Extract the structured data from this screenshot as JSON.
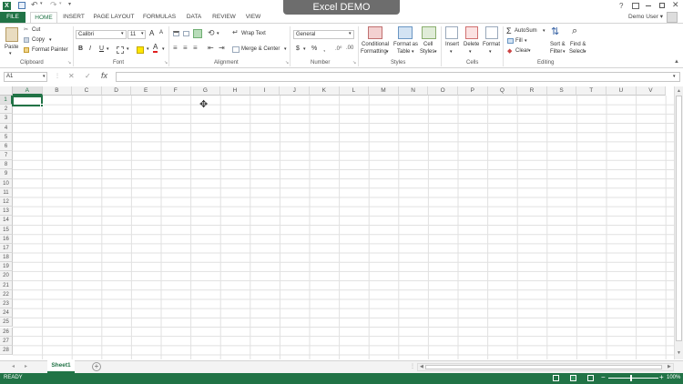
{
  "title": "Excel DEMO",
  "user": "Demo User",
  "tabs": [
    "FILE",
    "HOME",
    "INSERT",
    "PAGE LAYOUT",
    "FORMULAS",
    "DATA",
    "REVIEW",
    "VIEW"
  ],
  "clipboard": {
    "paste": "Paste",
    "cut": "Cut",
    "copy": "Copy",
    "format_painter": "Format Painter",
    "label": "Clipboard"
  },
  "font": {
    "name": "Calibri",
    "size": "11",
    "bold": "B",
    "italic": "I",
    "underline": "U",
    "grow": "A",
    "shrink": "A",
    "label": "Font"
  },
  "alignment": {
    "wrap": "Wrap Text",
    "merge": "Merge & Center",
    "label": "Alignment"
  },
  "number": {
    "format": "General",
    "currency": "$",
    "percent": "%",
    "comma": ",",
    "label": "Number"
  },
  "styles": {
    "conditional": "Conditional",
    "conditional2": "Formatting",
    "format_as": "Format as",
    "format_as2": "Table",
    "cell_styles": "Cell",
    "cell_styles2": "Styles",
    "label": "Styles"
  },
  "cells": {
    "insert": "Insert",
    "delete": "Delete",
    "format": "Format",
    "label": "Cells"
  },
  "editing": {
    "autosum": "AutoSum",
    "fill": "Fill",
    "clear": "Clear",
    "sort": "Sort &",
    "sort2": "Filter",
    "find": "Find &",
    "find2": "Select",
    "label": "Editing"
  },
  "formula_bar": {
    "name_box": "A1",
    "fx": "fx",
    "cancel": "✕",
    "enter": "✓",
    "value": ""
  },
  "columns": [
    "A",
    "B",
    "C",
    "D",
    "E",
    "F",
    "G",
    "H",
    "I",
    "J",
    "K",
    "L",
    "M",
    "N",
    "O",
    "P",
    "Q",
    "R",
    "S",
    "T",
    "U",
    "V"
  ],
  "rows": [
    "1",
    "2",
    "3",
    "4",
    "5",
    "6",
    "7",
    "8",
    "9",
    "10",
    "11",
    "12",
    "13",
    "14",
    "15",
    "16",
    "17",
    "18",
    "19",
    "20",
    "21",
    "22",
    "23",
    "24",
    "25",
    "26",
    "27",
    "28"
  ],
  "sheet": "Sheet1",
  "status": "READY",
  "zoom": "100%",
  "colors": {
    "accent": "#217346",
    "grid": "#e1e1e1",
    "header_bg": "#f3f3f3"
  }
}
